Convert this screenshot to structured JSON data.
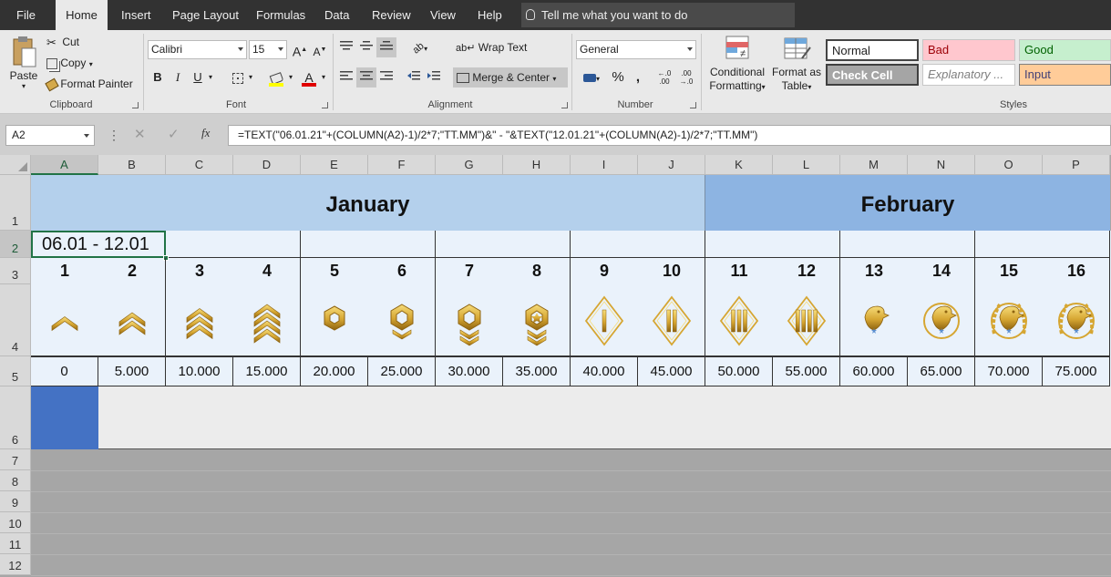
{
  "tabs": [
    "File",
    "Home",
    "Insert",
    "Page Layout",
    "Formulas",
    "Data",
    "Review",
    "View",
    "Help"
  ],
  "tell_me": "Tell me what you want to do",
  "clipboard": {
    "paste": "Paste",
    "cut": "Cut",
    "copy": "Copy",
    "format_painter": "Format Painter",
    "group": "Clipboard"
  },
  "font": {
    "name": "Calibri",
    "size": "15",
    "bold": "B",
    "italic": "I",
    "underline": "U",
    "grow": "A",
    "shrink": "A",
    "font_color": "A",
    "group": "Font"
  },
  "alignment": {
    "wrap_text": "Wrap Text",
    "merge_center": "Merge & Center",
    "group": "Alignment"
  },
  "number": {
    "format": "General",
    "percent": "%",
    "comma": ",",
    "inc_dec": "←.0\n.00",
    "dec_dec": ".00\n→.0",
    "group": "Number"
  },
  "styles_group": {
    "conditional": "Conditional",
    "formatting": "Formatting",
    "format_as": "Format as",
    "table": "Table",
    "group": "Styles"
  },
  "styles": {
    "normal": "Normal",
    "bad": "Bad",
    "good": "Good",
    "check_cell": "Check Cell",
    "explanatory": "Explanatory ...",
    "input": "Input"
  },
  "colors": {
    "bad_bg": "#ffc7ce",
    "bad_fg": "#9c0006",
    "good_bg": "#c6efce",
    "good_fg": "#006100",
    "input_bg": "#ffcc99",
    "input_fg": "#3f3f76",
    "check_bg": "#a5a5a5",
    "jan_band": "#b4d0ec",
    "feb_band": "#8db4e2",
    "row2_bg": "#eaf2fb",
    "row6_blue": "#4472c4",
    "accent": "#217346"
  },
  "formula_bar": {
    "name_box": "A2",
    "cancel": "✕",
    "enter": "✓",
    "fx": "fx",
    "formula": "=TEXT(\"06.01.21\"+(COLUMN(A2)-1)/2*7;\"TT.MM\")&\" - \"&TEXT(\"12.01.21\"+(COLUMN(A2)-1)/2*7;\"TT.MM\")"
  },
  "columns": [
    "A",
    "B",
    "C",
    "D",
    "E",
    "F",
    "G",
    "H",
    "I",
    "J",
    "K",
    "L",
    "M",
    "N",
    "O",
    "P"
  ],
  "rows": [
    "1",
    "2",
    "3",
    "4",
    "5",
    "6",
    "7",
    "8",
    "9",
    "10",
    "11",
    "12"
  ],
  "sheet": {
    "month_january": "January",
    "month_february": "February",
    "a2_value": "06.01 - 12.01",
    "rank_numbers": [
      "1",
      "2",
      "3",
      "4",
      "5",
      "6",
      "7",
      "8",
      "9",
      "10",
      "11",
      "12",
      "13",
      "14",
      "15",
      "16"
    ],
    "xp_values": [
      "0",
      "5.000",
      "10.000",
      "15.000",
      "20.000",
      "25.000",
      "30.000",
      "35.000",
      "40.000",
      "45.000",
      "50.000",
      "55.000",
      "60.000",
      "65.000",
      "70.000",
      "75.000"
    ],
    "rank_icons": [
      "chevron-1-icon",
      "chevron-2-icon",
      "chevron-3-icon",
      "chevron-4-icon",
      "hexagon-icon",
      "hexagon-chevron-icon",
      "hexagon-chevron-2-icon",
      "star-hexagon-icon",
      "diamond-bar-1-icon",
      "diamond-bar-2-icon",
      "diamond-bar-3-icon",
      "diamond-bar-4-icon",
      "eagle-icon",
      "eagle-ring-icon",
      "eagle-wreath-icon",
      "eagle-wreath-star-icon"
    ]
  }
}
